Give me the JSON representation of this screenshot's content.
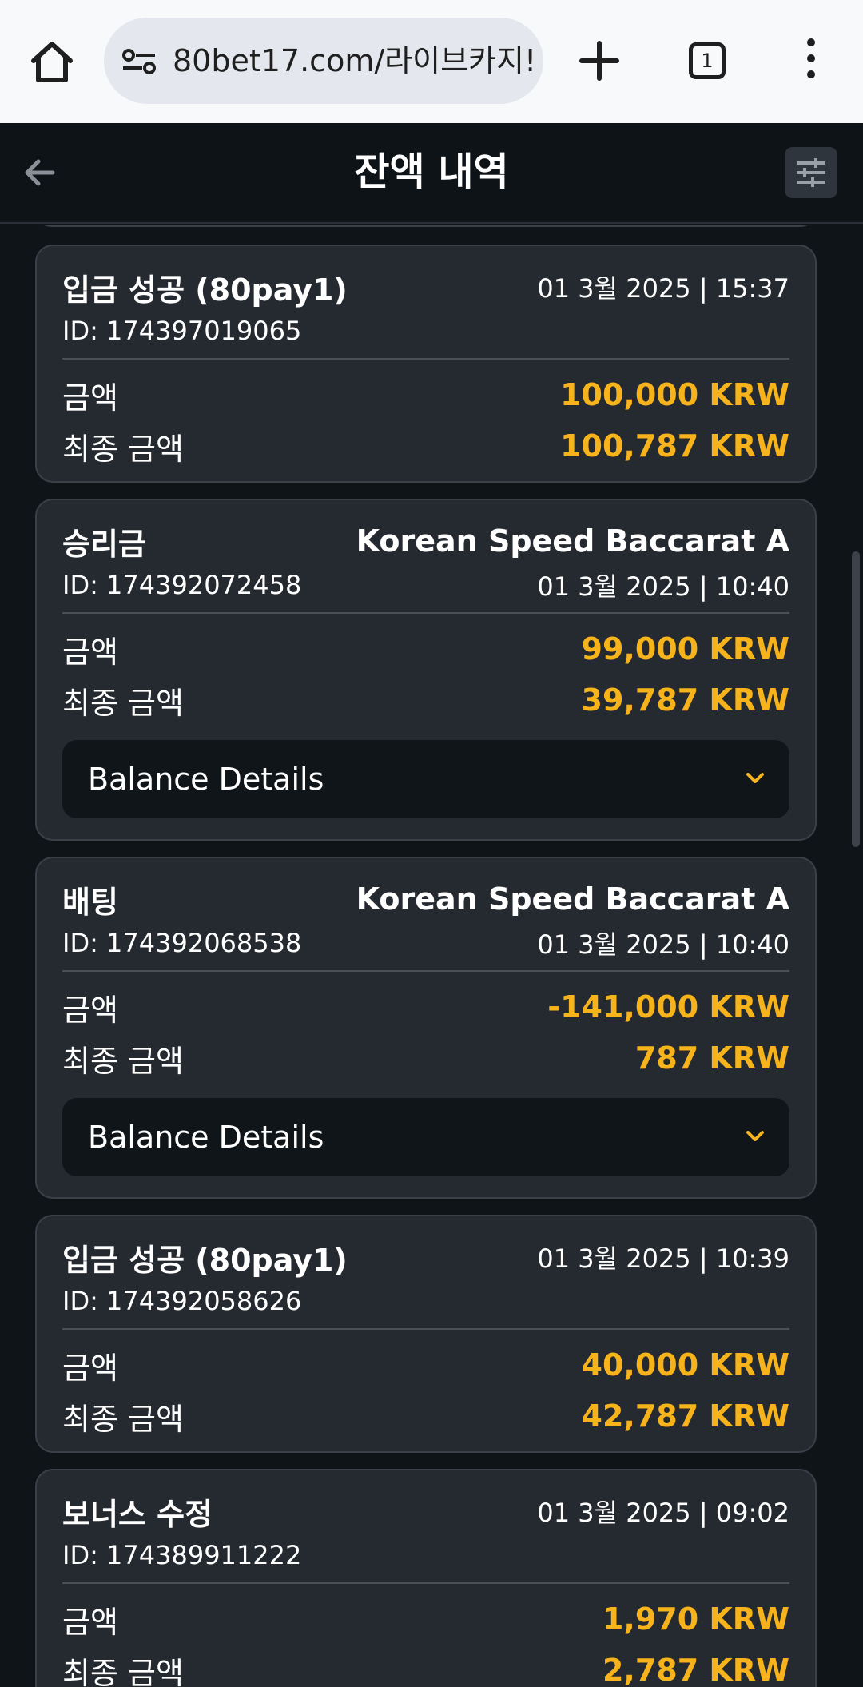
{
  "browser": {
    "url": "80bet17.com/라이브카지!",
    "tab_count": "1"
  },
  "header": {
    "title": "잔액 내역"
  },
  "colors": {
    "accent": "#f6b31b",
    "card_bg": "#252a31",
    "page_bg": "#0f1419"
  },
  "labels": {
    "amount": "금액",
    "final_amount": "최종 금액",
    "balance_details": "Balance Details"
  },
  "cards": [
    {
      "type": "입금 성공 (80pay1)",
      "game": "",
      "id": "ID: 174397019065",
      "datetime": "01 3월 2025 | 15:37",
      "amount": "100,000 KRW",
      "final_amount": "100,787 KRW",
      "has_details": false
    },
    {
      "type": "승리금",
      "game": "Korean Speed Baccarat A",
      "id": "ID: 174392072458",
      "datetime": "01 3월 2025 | 10:40",
      "amount": "99,000 KRW",
      "final_amount": "39,787 KRW",
      "has_details": true
    },
    {
      "type": "배팅",
      "game": "Korean Speed Baccarat A",
      "id": "ID: 174392068538",
      "datetime": "01 3월 2025 | 10:40",
      "amount": "-141,000 KRW",
      "final_amount": "787 KRW",
      "has_details": true
    },
    {
      "type": "입금 성공 (80pay1)",
      "game": "",
      "id": "ID: 174392058626",
      "datetime": "01 3월 2025 | 10:39",
      "amount": "40,000 KRW",
      "final_amount": "42,787 KRW",
      "has_details": false
    },
    {
      "type": "보너스 수정",
      "game": "",
      "id": "ID: 174389911222",
      "datetime": "01 3월 2025 | 09:02",
      "amount": "1,970 KRW",
      "final_amount": "2,787 KRW",
      "has_details": false
    }
  ]
}
